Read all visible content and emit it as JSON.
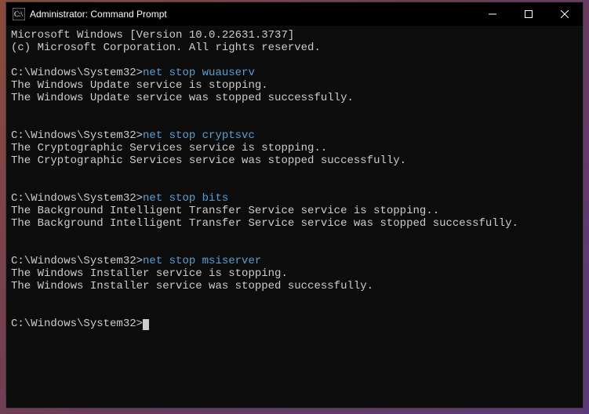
{
  "window": {
    "title": "Administrator: Command Prompt"
  },
  "header": {
    "line1": "Microsoft Windows [Version 10.0.22631.3737]",
    "line2": "(c) Microsoft Corporation. All rights reserved."
  },
  "prompt": "C:\\Windows\\System32>",
  "blocks": [
    {
      "command": "net stop wuauserv",
      "output1": "The Windows Update service is stopping.",
      "output2": "The Windows Update service was stopped successfully."
    },
    {
      "command": "net stop cryptsvc",
      "output1": "The Cryptographic Services service is stopping..",
      "output2": "The Cryptographic Services service was stopped successfully."
    },
    {
      "command": "net stop bits",
      "output1": "The Background Intelligent Transfer Service service is stopping..",
      "output2": "The Background Intelligent Transfer Service service was stopped successfully."
    },
    {
      "command": "net stop msiserver",
      "output1": "The Windows Installer service is stopping.",
      "output2": "The Windows Installer service was stopped successfully."
    }
  ]
}
